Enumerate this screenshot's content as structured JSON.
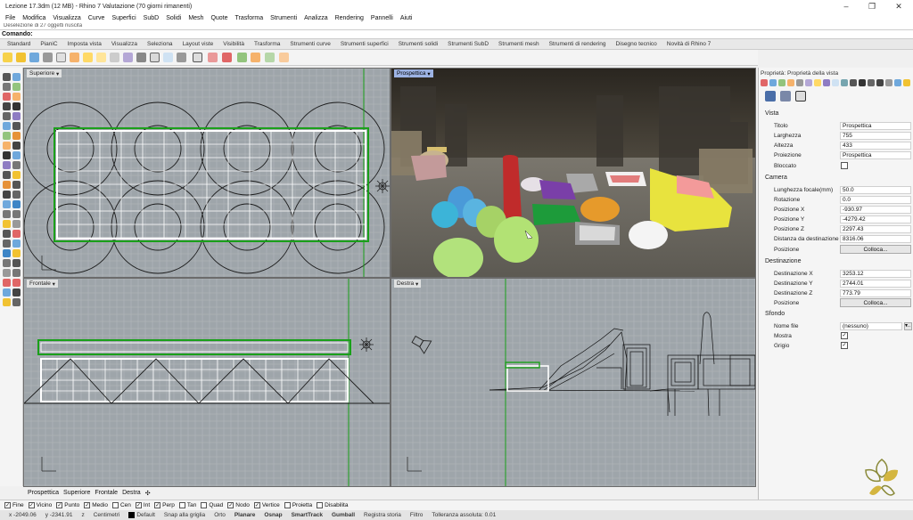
{
  "window": {
    "title": "Lezione 17.3dm (12 MB) - Rhino 7 Valutazione (70 giorni rimanenti)",
    "minimize": "–",
    "maximize": "❐",
    "close": "✕"
  },
  "menu": [
    "File",
    "Modifica",
    "Visualizza",
    "Curve",
    "Superfici",
    "SubD",
    "Solidi",
    "Mesh",
    "Quote",
    "Trasforma",
    "Strumenti",
    "Analizza",
    "Rendering",
    "Pannelli",
    "Aiuti"
  ],
  "history_text": "Deselezione di 27 oggetti riuscita",
  "command": {
    "label": "Comando:"
  },
  "toolbar_tabs": [
    "Standard",
    "PianiC",
    "Imposta vista",
    "Visualizza",
    "Seleziona",
    "Layout viste",
    "Visibilità",
    "Trasforma",
    "Strumenti curve",
    "Strumenti superfici",
    "Strumenti solidi",
    "Strumenti SubD",
    "Strumenti mesh",
    "Strumenti di rendering",
    "Disegno tecnico",
    "Novità di Rhino 7"
  ],
  "viewports": {
    "top": {
      "label": "Superiore"
    },
    "perspective": {
      "label": "Prospettica"
    },
    "front": {
      "label": "Frontale"
    },
    "right": {
      "label": "Destra"
    },
    "dropdown": "▾"
  },
  "viewport_tabs": [
    "Prospettica",
    "Superiore",
    "Frontale",
    "Destra"
  ],
  "viewport_tabs_add": "✣",
  "osnaps": [
    {
      "label": "Fine",
      "checked": true
    },
    {
      "label": "Vicino",
      "checked": true
    },
    {
      "label": "Punto",
      "checked": true
    },
    {
      "label": "Medio",
      "checked": true
    },
    {
      "label": "Cen",
      "checked": false
    },
    {
      "label": "Int",
      "checked": true
    },
    {
      "label": "Perp",
      "checked": true
    },
    {
      "label": "Tan",
      "checked": false
    },
    {
      "label": "Quad",
      "checked": false
    },
    {
      "label": "Nodo",
      "checked": true
    },
    {
      "label": "Vertice",
      "checked": true
    },
    {
      "label": "Proietta",
      "checked": false
    },
    {
      "label": "Disabilita",
      "checked": false
    }
  ],
  "check_glyph": "✓",
  "status": {
    "x": "x -2049.06",
    "y": "y -2341.91",
    "z": "z",
    "units": "Centimetri",
    "layer": "Default",
    "snap": "Snap alla griglia",
    "orto": "Orto",
    "planare": "Planare",
    "osnap": "Osnap",
    "smarttrack": "SmartTrack",
    "gumball": "Gumball",
    "history": "Registra storia",
    "filter": "Filtro",
    "tolerance": "Tolleranza assoluta: 0.01"
  },
  "panel": {
    "title": "Proprietà: Proprietà della vista",
    "vista_header": "Vista",
    "vista": [
      {
        "k": "Titolo",
        "v": "Prospettica"
      },
      {
        "k": "Larghezza",
        "v": "755"
      },
      {
        "k": "Altezza",
        "v": "433"
      },
      {
        "k": "Proiezione",
        "v": "Prospettica"
      }
    ],
    "bloccato": "Bloccato",
    "camera_header": "Camera",
    "camera": [
      {
        "k": "Lunghezza focale(mm)",
        "v": "50.0"
      },
      {
        "k": "Rotazione",
        "v": "0.0"
      },
      {
        "k": "Posizione X",
        "v": "-930.97"
      },
      {
        "k": "Posizione Y",
        "v": "-4279.42"
      },
      {
        "k": "Posizione Z",
        "v": "2297.43"
      },
      {
        "k": "Distanza da destinazione",
        "v": "8316.06"
      }
    ],
    "posizione_label": "Posizione",
    "colloca": "Colloca...",
    "destinazione_header": "Destinazione",
    "destinazione": [
      {
        "k": "Destinazione X",
        "v": "3253.12"
      },
      {
        "k": "Destinazione Y",
        "v": "2744.01"
      },
      {
        "k": "Destinazione Z",
        "v": "773.79"
      }
    ],
    "sfondo_header": "Sfondo",
    "nome_file": {
      "k": "Nome file",
      "v": "(nessuno)"
    },
    "browse": "...",
    "mostra": "Mostra",
    "grigio": "Grigio"
  }
}
